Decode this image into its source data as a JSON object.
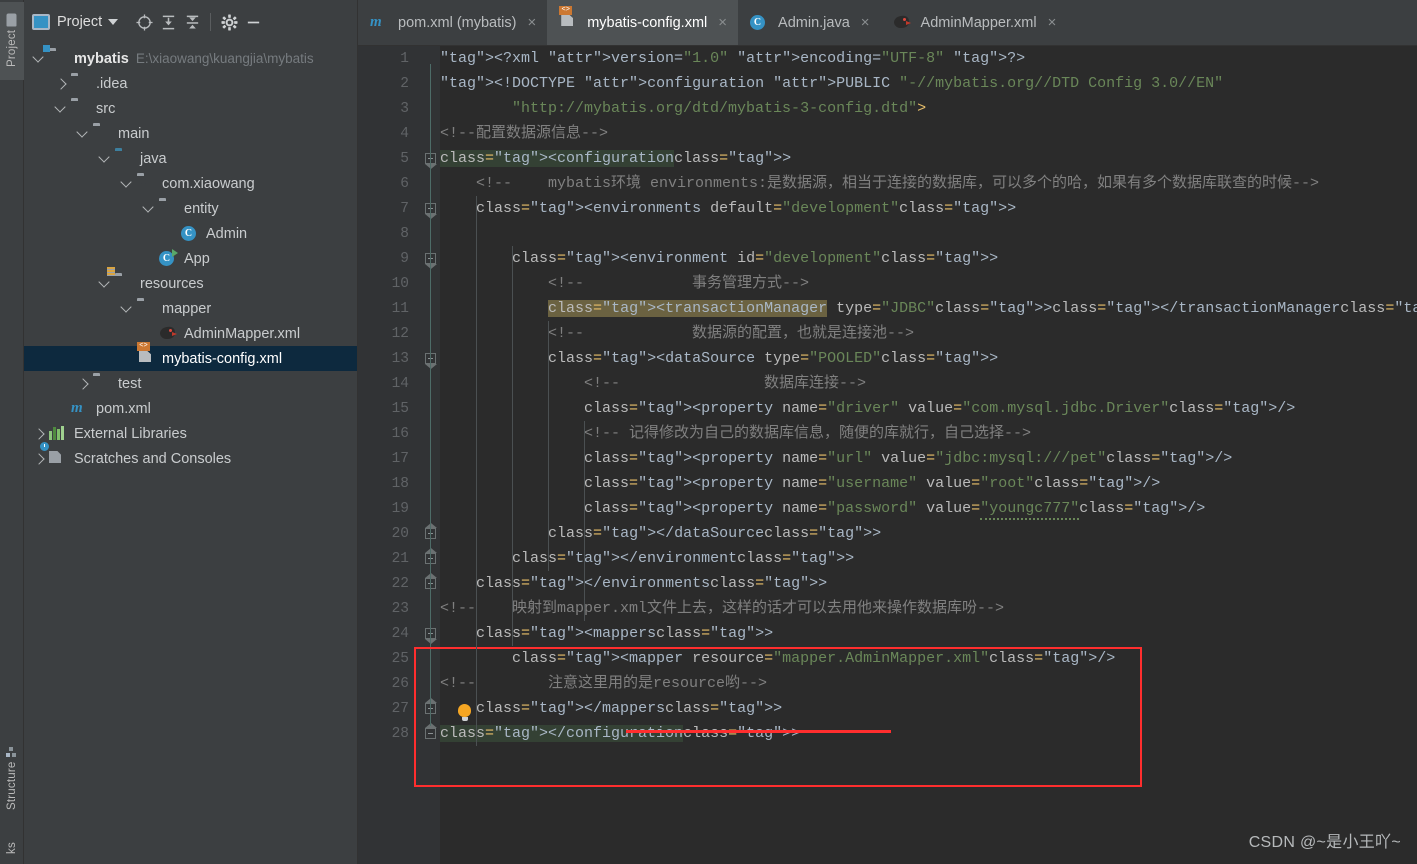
{
  "toolwindows": {
    "left": [
      {
        "label": "Project",
        "icon": "folder-icon",
        "active": true
      },
      {
        "label": "Structure",
        "icon": "structure-icon",
        "active": false
      },
      {
        "label": "ks",
        "icon": "bookmarks-icon",
        "active": false
      }
    ]
  },
  "project_panel": {
    "header": {
      "title": "Project",
      "icons": [
        "project-view-icon",
        "chevron-down-icon",
        "locate-icon",
        "expand-all-icon",
        "collapse-all-icon",
        "settings-gear-icon",
        "hide-icon"
      ]
    },
    "tree": [
      {
        "depth": 0,
        "twisty": "expanded",
        "icon": "module-folder-icon",
        "label": "mybatis",
        "bold": true,
        "path": "E:\\xiaowang\\kuangjia\\mybatis",
        "selected": false
      },
      {
        "depth": 1,
        "twisty": "collapsed",
        "icon": "folder-icon",
        "label": ".idea",
        "selected": false
      },
      {
        "depth": 1,
        "twisty": "expanded",
        "icon": "folder-icon",
        "label": "src",
        "selected": false
      },
      {
        "depth": 2,
        "twisty": "expanded",
        "icon": "folder-icon",
        "label": "main",
        "selected": false
      },
      {
        "depth": 3,
        "twisty": "expanded",
        "icon": "source-root-icon",
        "label": "java",
        "selected": false
      },
      {
        "depth": 4,
        "twisty": "expanded",
        "icon": "package-icon",
        "label": "com.xiaowang",
        "selected": false
      },
      {
        "depth": 5,
        "twisty": "expanded",
        "icon": "package-icon",
        "label": "entity",
        "selected": false
      },
      {
        "depth": 6,
        "twisty": "none",
        "icon": "java-class-icon",
        "label": "Admin",
        "selected": false
      },
      {
        "depth": 5,
        "twisty": "none",
        "icon": "java-runnable-class-icon",
        "label": "App",
        "selected": false
      },
      {
        "depth": 3,
        "twisty": "expanded",
        "icon": "resources-root-icon",
        "label": "resources",
        "selected": false
      },
      {
        "depth": 4,
        "twisty": "expanded",
        "icon": "folder-icon",
        "label": "mapper",
        "selected": false
      },
      {
        "depth": 5,
        "twisty": "none",
        "icon": "mybatis-mapper-icon",
        "label": "AdminMapper.xml",
        "selected": false
      },
      {
        "depth": 4,
        "twisty": "none",
        "icon": "xml-file-icon",
        "label": "mybatis-config.xml",
        "selected": true
      },
      {
        "depth": 2,
        "twisty": "collapsed",
        "icon": "folder-icon",
        "label": "test",
        "selected": false
      },
      {
        "depth": 1,
        "twisty": "none",
        "icon": "maven-icon",
        "label": "pom.xml",
        "selected": false
      },
      {
        "depth": 0,
        "twisty": "collapsed",
        "icon": "external-libraries-icon",
        "label": "External Libraries",
        "selected": false
      },
      {
        "depth": 0,
        "twisty": "collapsed",
        "icon": "scratches-icon",
        "label": "Scratches and Consoles",
        "selected": false
      }
    ]
  },
  "editor": {
    "tabs": [
      {
        "label": "pom.xml (mybatis)",
        "icon": "maven-icon",
        "active": false,
        "close": "×"
      },
      {
        "label": "mybatis-config.xml",
        "icon": "xml-file-icon",
        "active": true,
        "close": "×"
      },
      {
        "label": "Admin.java",
        "icon": "java-class-icon",
        "active": false,
        "close": "×"
      },
      {
        "label": "AdminMapper.xml",
        "icon": "mybatis-mapper-icon",
        "active": false,
        "close": "×"
      }
    ],
    "line_numbers": [
      1,
      2,
      3,
      4,
      5,
      6,
      7,
      8,
      9,
      10,
      11,
      12,
      13,
      14,
      15,
      16,
      17,
      18,
      19,
      20,
      21,
      22,
      23,
      24,
      25,
      26,
      27,
      28
    ],
    "lines": [
      {
        "n": 1,
        "text": "<?xml version=\"1.0\" encoding=\"UTF-8\" ?>"
      },
      {
        "n": 2,
        "text": "<!DOCTYPE configuration PUBLIC \"-//mybatis.org//DTD Config 3.0//EN\""
      },
      {
        "n": 3,
        "text": "        \"http://mybatis.org/dtd/mybatis-3-config.dtd\">"
      },
      {
        "n": 4,
        "text": "<!--配置数据源信息-->"
      },
      {
        "n": 5,
        "text": "<configuration>"
      },
      {
        "n": 6,
        "text": "    <!--    mybatis环境 environments:是数据源，相当于连接的数据库，可以多个的哈，如果有多个数据库联查的时候-->"
      },
      {
        "n": 7,
        "text": "    <environments default=\"development\">"
      },
      {
        "n": 8,
        "text": ""
      },
      {
        "n": 9,
        "text": "        <environment id=\"development\">"
      },
      {
        "n": 10,
        "text": "            <!--            事务管理方式-->"
      },
      {
        "n": 11,
        "text": "            <transactionManager type=\"JDBC\"></transactionManager>"
      },
      {
        "n": 12,
        "text": "            <!--            数据源的配置，也就是连接池-->"
      },
      {
        "n": 13,
        "text": "            <dataSource type=\"POOLED\">"
      },
      {
        "n": 14,
        "text": "                <!--                数据库连接-->"
      },
      {
        "n": 15,
        "text": "                <property name=\"driver\" value=\"com.mysql.jdbc.Driver\"/>"
      },
      {
        "n": 16,
        "text": "                <!-- 记得修改为自己的数据库信息，随便的库就行，自己选择-->"
      },
      {
        "n": 17,
        "text": "                <property name=\"url\" value=\"jdbc:mysql:///pet\"/>"
      },
      {
        "n": 18,
        "text": "                <property name=\"username\" value=\"root\"/>"
      },
      {
        "n": 19,
        "text": "                <property name=\"password\" value=\"youngc777\"/>"
      },
      {
        "n": 20,
        "text": "            </dataSource>"
      },
      {
        "n": 21,
        "text": "        </environment>"
      },
      {
        "n": 22,
        "text": "    </environments>"
      },
      {
        "n": 23,
        "text": "<!--    映射到mapper.xml文件上去，这样的话才可以去用他来操作数据库吩-->"
      },
      {
        "n": 24,
        "text": "    <mappers>"
      },
      {
        "n": 25,
        "text": "        <mapper resource=\"mapper.AdminMapper.xml\"/>"
      },
      {
        "n": 26,
        "text": "<!--        注意这里用的是resource哟-->"
      },
      {
        "n": 27,
        "text": "    </mappers>"
      },
      {
        "n": 28,
        "text": "</configuration>"
      }
    ],
    "annotations": {
      "red_box_label": "highlight-box",
      "red_underline_label": "highlight-underline",
      "bulb_label": "intention-bulb-icon"
    }
  },
  "watermark": "CSDN @~是小王吖~",
  "colors": {
    "panel_bg": "#3c3f41",
    "editor_bg": "#2b2b2b",
    "gutter_bg": "#313335",
    "selection_bg": "#0d293e",
    "tag": "#e8bf6a",
    "string": "#6a8759",
    "comment": "#808080",
    "attribute": "#bababa",
    "accent_red": "#ff2e2e",
    "accent_blue": "#3592c4",
    "orange": "#cc7832"
  }
}
